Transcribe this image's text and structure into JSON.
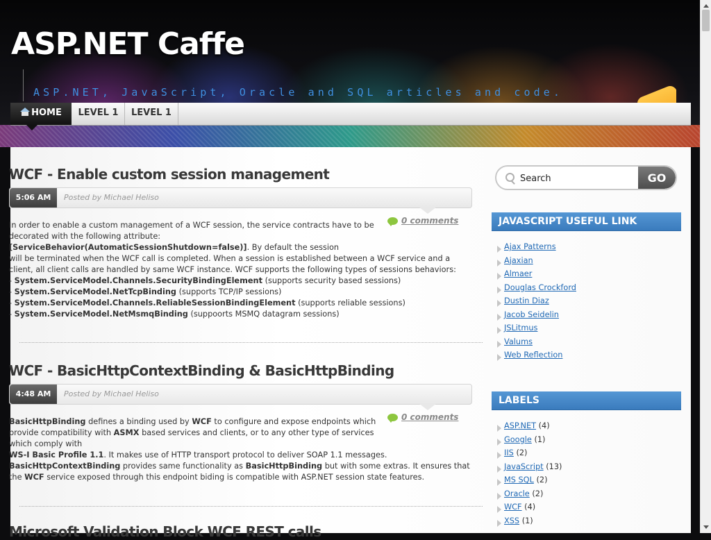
{
  "site": {
    "title": "ASP.NET Caffe",
    "tagline": "ASP.NET, JavaScript, Oracle and SQL articles and code."
  },
  "nav": {
    "items": [
      {
        "label": "HOME",
        "active": true
      },
      {
        "label": "LEVEL 1"
      },
      {
        "label": "LEVEL 1"
      }
    ]
  },
  "posts": [
    {
      "title": "WCF - Enable custom session management",
      "time": "5:06 AM",
      "author": "Posted by Michael Heliso",
      "comments": "0 comments",
      "body": {
        "intro": "In order to enable a custom management of a WCF session, the service contracts have to be decorated",
        "intro2": "with the following attribute: ",
        "attr": "[ServiceBehavior(AutomaticSessionShutdown=false)]",
        "intro3": ". By default the session",
        "cont": "will be terminated when the WCF call is completed. When a session is established between a WCF service and a client, all client calls are handled by same WCF instance. WCF supports the following types of sessions behaviors:",
        "bullets": [
          {
            "name": "System.ServiceModel.Channels.SecurityBindingElement",
            "desc": " (supports security based sessions)"
          },
          {
            "name": "System.ServiceModel.NetTcpBinding",
            "desc": " (supports TCP/IP sessions)"
          },
          {
            "name": "System.ServiceModel.Channels.ReliableSessionBindingElement",
            "desc": " (supports reliable sessions)"
          },
          {
            "name": "System.ServiceModel.NetMsmqBinding",
            "desc": " (suppoorts MSMQ datagram sessions)"
          }
        ]
      }
    },
    {
      "title": "WCF - BasicHttpContextBinding & BasicHttpBinding",
      "time": "4:48 AM",
      "author": "Posted by Michael Heliso",
      "comments": "0 comments",
      "body": {
        "b1": "BasicHttpBinding",
        "t1": " defines a binding used by ",
        "b2": "WCF",
        "t2": " to configure and expose endpoints which provide",
        "t3": "compatibility with ",
        "b3": "ASMX",
        "t4": " based services and clients, or to any other type of services which comply with",
        "b4": "WS-I Basic Profile 1.1",
        "t5": ". It makes use of HTTP transport protocol to deliver SOAP 1.1 messages. ",
        "b5": "BasicHttpContextBinding",
        "t6": " provides same functionality as ",
        "b6": "BasicHttpBinding",
        "t7": " but with some extras. It ensures that the ",
        "b7": "WCF",
        "t8": " service exposed through this endpoint biding is compatible with ASP.NET session state features."
      }
    },
    {
      "title": "Microsoft Validation Block WCF REST calls"
    }
  ],
  "search": {
    "placeholder": "Search",
    "button": "GO"
  },
  "sidebar": {
    "links_title": "JAVASCRIPT USEFUL LINK",
    "links": [
      "Ajax Patterns",
      "Ajaxian",
      "Almaer",
      "Douglas Crockford",
      "Dustin Diaz",
      "Jacob Seidelin",
      "JSLitmus",
      "Valums",
      "Web Reflection"
    ],
    "labels_title": "LABELS",
    "labels": [
      {
        "name": "ASP.NET",
        "count": "(4)"
      },
      {
        "name": "Google",
        "count": "(1)"
      },
      {
        "name": "IIS",
        "count": "(2)"
      },
      {
        "name": "JavaScript",
        "count": "(13)"
      },
      {
        "name": "MS SQL",
        "count": "(2)"
      },
      {
        "name": "Oracle",
        "count": "(2)"
      },
      {
        "name": "WCF",
        "count": "(4)"
      },
      {
        "name": "XSS",
        "count": "(1)"
      }
    ]
  },
  "colors": {
    "accent_blue": "#3a7bbd",
    "tagline": "#3f8fe0",
    "link": "#2069b5",
    "comment_bubble": "#8dc63f"
  }
}
